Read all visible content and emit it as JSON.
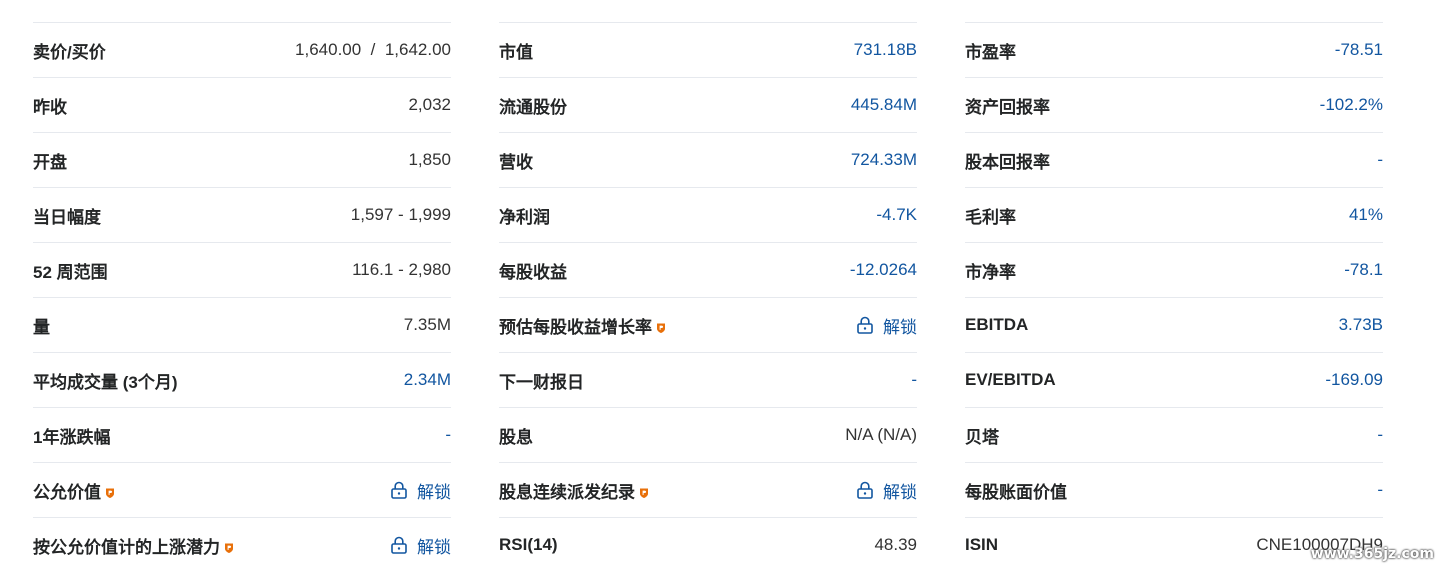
{
  "columns": [
    {
      "rows": [
        {
          "label": "卖价/买价",
          "value": "1,640.00  /  1,642.00",
          "style": "plain"
        },
        {
          "label": "昨收",
          "value": "2,032",
          "style": "plain"
        },
        {
          "label": "开盘",
          "value": "1,850",
          "style": "plain"
        },
        {
          "label": "当日幅度",
          "value": "1,597 - 1,999",
          "style": "plain"
        },
        {
          "label": "52 周范围",
          "value": "116.1 - 2,980",
          "style": "plain"
        },
        {
          "label": "量",
          "value": "7.35M",
          "style": "plain"
        },
        {
          "label": "平均成交量 (3个月)",
          "value": "2.34M",
          "style": "link"
        },
        {
          "label": "1年涨跌幅",
          "value": "-",
          "style": "link"
        },
        {
          "label": "公允价值",
          "value": "解锁",
          "style": "unlock",
          "pro": true
        },
        {
          "label": "按公允价值计的上涨潜力",
          "value": "解锁",
          "style": "unlock",
          "pro": true
        }
      ]
    },
    {
      "rows": [
        {
          "label": "市值",
          "value": "731.18B",
          "style": "link"
        },
        {
          "label": "流通股份",
          "value": "445.84M",
          "style": "link"
        },
        {
          "label": "营收",
          "value": "724.33M",
          "style": "link"
        },
        {
          "label": "净利润",
          "value": "-4.7K",
          "style": "link"
        },
        {
          "label": "每股收益",
          "value": "-12.0264",
          "style": "link"
        },
        {
          "label": "预估每股收益增长率",
          "value": "解锁",
          "style": "unlock",
          "pro": true
        },
        {
          "label": "下一财报日",
          "value": "-",
          "style": "link"
        },
        {
          "label": "股息",
          "value": "N/A (N/A)",
          "style": "plain"
        },
        {
          "label": "股息连续派发纪录",
          "value": "解锁",
          "style": "unlock",
          "pro": true
        },
        {
          "label": "RSI(14)",
          "value": "48.39",
          "style": "plain"
        }
      ]
    },
    {
      "rows": [
        {
          "label": "市盈率",
          "value": "-78.51",
          "style": "link"
        },
        {
          "label": "资产回报率",
          "value": "-102.2%",
          "style": "link"
        },
        {
          "label": "股本回报率",
          "value": "-",
          "style": "link"
        },
        {
          "label": "毛利率",
          "value": "41%",
          "style": "link"
        },
        {
          "label": "市净率",
          "value": "-78.1",
          "style": "link"
        },
        {
          "label": "EBITDA",
          "value": "3.73B",
          "style": "link"
        },
        {
          "label": "EV/EBITDA",
          "value": "-169.09",
          "style": "link"
        },
        {
          "label": "贝塔",
          "value": "-",
          "style": "link"
        },
        {
          "label": "每股账面价值",
          "value": "-",
          "style": "link"
        },
        {
          "label": "ISIN",
          "value": "CNE100007DH9",
          "style": "plain"
        }
      ]
    }
  ],
  "watermark": "www.365jz.com",
  "colors": {
    "label": "#232526",
    "value": "#333333",
    "link": "#1256a0",
    "pro_badge": "#e8700a",
    "divider": "#e6e9ee"
  },
  "icons": {
    "pro_badge": "pro-badge-icon",
    "lock": "lock-icon"
  }
}
